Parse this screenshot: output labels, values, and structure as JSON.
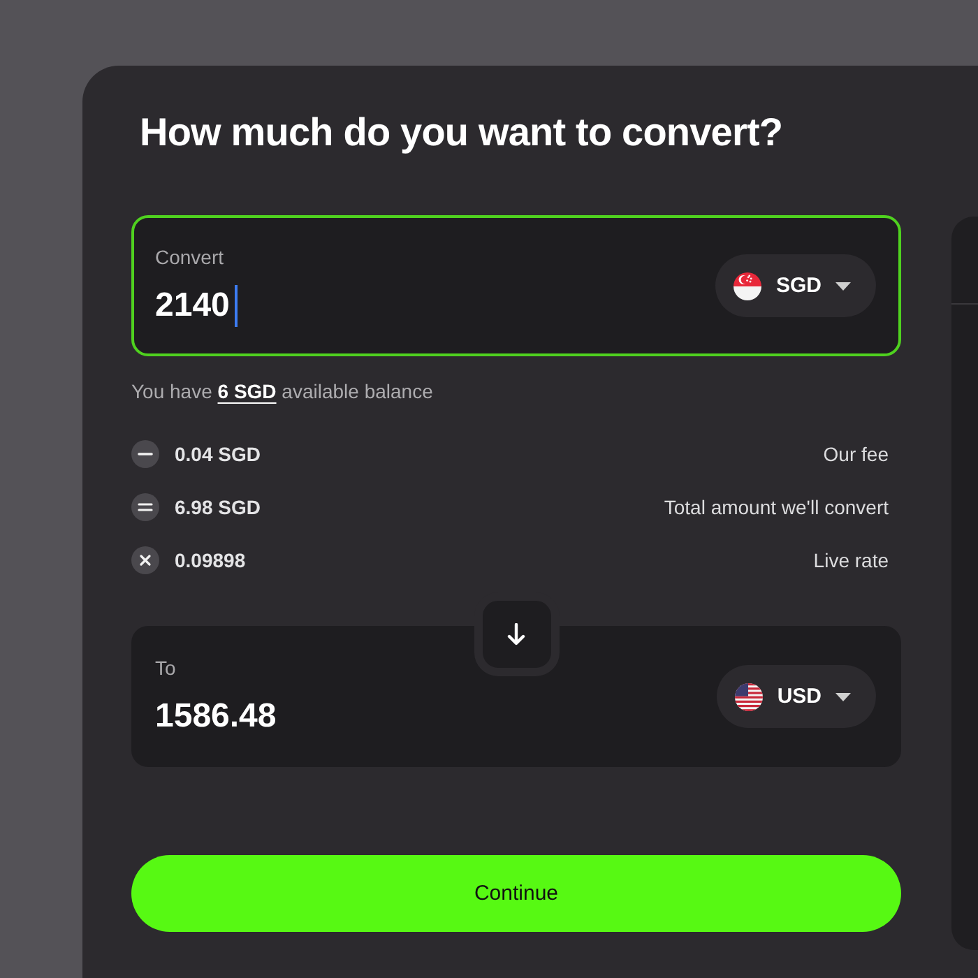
{
  "title": "How much do you want to convert?",
  "from": {
    "label": "Convert",
    "value": "2140",
    "focused": true,
    "currency": {
      "code": "SGD",
      "kind": "sg"
    }
  },
  "balance": {
    "before": "You have",
    "amount": "6 SGD",
    "after": "available balance"
  },
  "breakdown": [
    {
      "kind": "minus",
      "value": "0.04 SGD",
      "label": "Our fee"
    },
    {
      "kind": "equals",
      "value": "6.98 SGD",
      "label": "Total amount we'll convert"
    },
    {
      "kind": "times",
      "value": "0.09898",
      "label": "Live rate"
    }
  ],
  "to": {
    "label": "To",
    "value": "1586.48",
    "focused": false,
    "currency": {
      "code": "USD",
      "kind": "us"
    }
  },
  "continue_button": "Continue"
}
